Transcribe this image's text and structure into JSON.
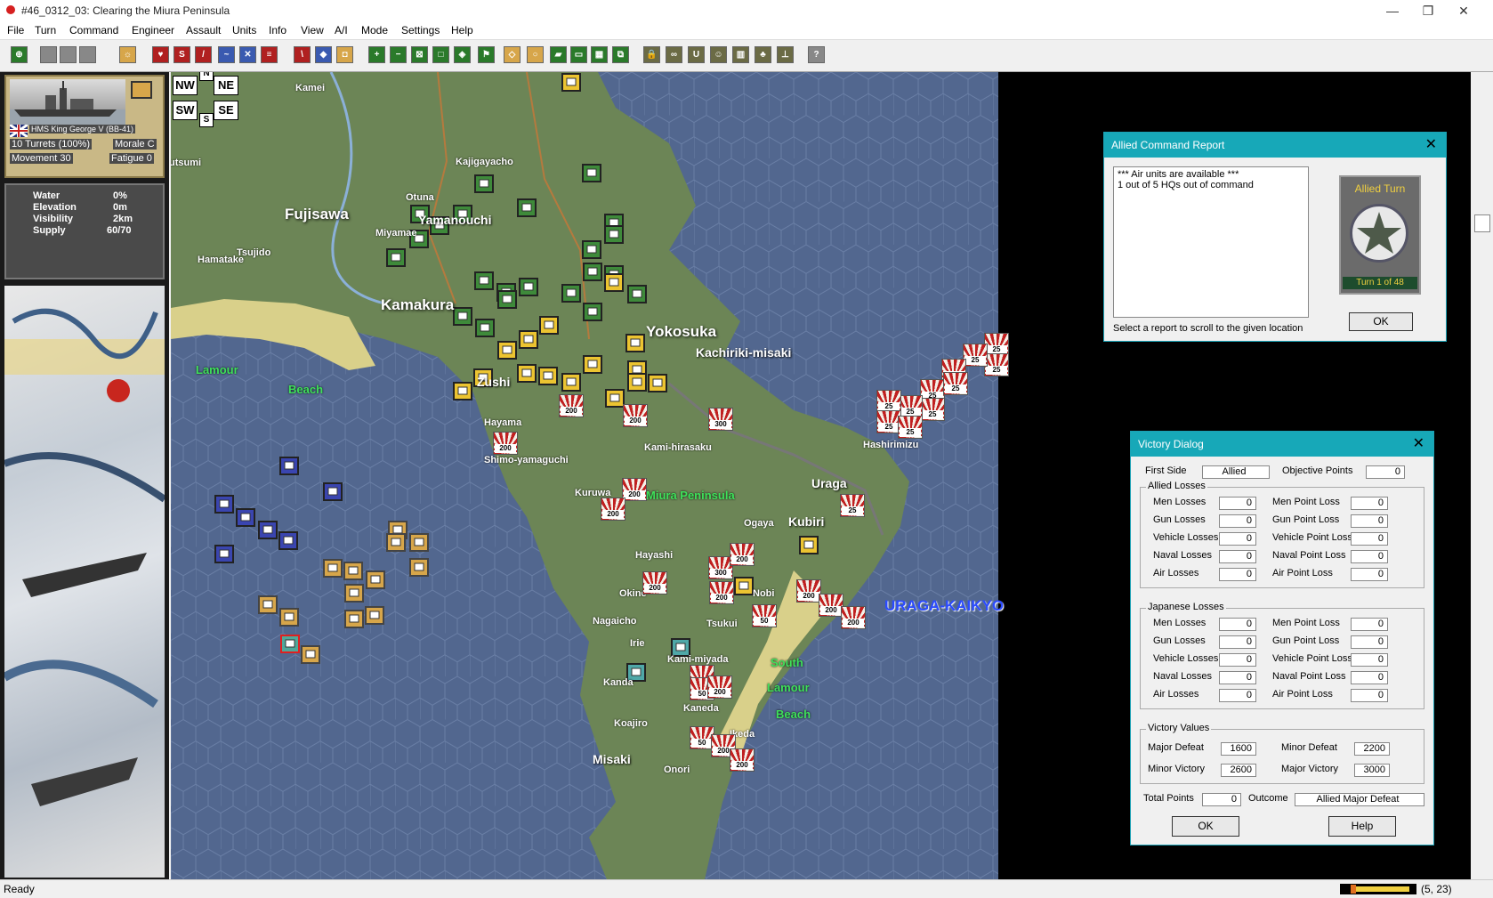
{
  "window": {
    "title": "#46_0312_03: Clearing the Miura Peninsula",
    "minimize": "—",
    "maximize": "❐",
    "close": "✕"
  },
  "menu": [
    "File",
    "Turn",
    "Command",
    "Engineer",
    "Assault",
    "Units",
    "Info",
    "View",
    "A/I",
    "Mode",
    "Settings",
    "Help"
  ],
  "unit_card": {
    "name": "HMS King George V (BB-41)",
    "turrets": "10 Turrets (100%)",
    "morale": "Morale C",
    "movement": "Movement 30",
    "fatigue": "Fatigue 0"
  },
  "terrain": {
    "labels": [
      "Water",
      "Elevation",
      "Visibility",
      "Supply"
    ],
    "values": [
      "0%",
      "0m",
      "2km",
      "60/70"
    ]
  },
  "compass": {
    "nw": "NW",
    "n": "N",
    "ne": "NE",
    "sw": "SW",
    "s": "S",
    "se": "SE"
  },
  "map_labels": [
    {
      "text": "Kamei",
      "kind": "small"
    },
    {
      "text": "Kajigayacho",
      "kind": "small"
    },
    {
      "text": "Tsutsumi",
      "kind": "small"
    },
    {
      "text": "Otuna",
      "kind": "small"
    },
    {
      "text": "Yamanouchi",
      "kind": "mid"
    },
    {
      "text": "Fujisawa",
      "kind": "big"
    },
    {
      "text": "Hamatake",
      "kind": "small"
    },
    {
      "text": "Tsujido",
      "kind": "small"
    },
    {
      "text": "Miyamae",
      "kind": "small"
    },
    {
      "text": "Kamakura",
      "kind": "big"
    },
    {
      "text": "Yokosuka",
      "kind": "big"
    },
    {
      "text": "Kachiriki-misaki",
      "kind": "mid"
    },
    {
      "text": "Lamour",
      "kind": "green"
    },
    {
      "text": "Beach",
      "kind": "green"
    },
    {
      "text": "Zushi",
      "kind": "mid"
    },
    {
      "text": "Hayama",
      "kind": "small"
    },
    {
      "text": "Shimo-yamaguchi",
      "kind": "small"
    },
    {
      "text": "Kami-hirasaku",
      "kind": "small"
    },
    {
      "text": "Hashirimizu",
      "kind": "small"
    },
    {
      "text": "Kuruwa",
      "kind": "small"
    },
    {
      "text": "Miura Peninsula",
      "kind": "green"
    },
    {
      "text": "Uraga",
      "kind": "mid"
    },
    {
      "text": "Ogaya",
      "kind": "small"
    },
    {
      "text": "Kubiri",
      "kind": "mid"
    },
    {
      "text": "Hayashi",
      "kind": "small"
    },
    {
      "text": "Okine",
      "kind": "small"
    },
    {
      "text": "Nobi",
      "kind": "small"
    },
    {
      "text": "Nagaicho",
      "kind": "small"
    },
    {
      "text": "Tsukui",
      "kind": "small"
    },
    {
      "text": "URAGA-KAIKYO",
      "kind": "blue"
    },
    {
      "text": "Irie",
      "kind": "small"
    },
    {
      "text": "Kami-miyada",
      "kind": "small"
    },
    {
      "text": "South",
      "kind": "green"
    },
    {
      "text": "Lamour",
      "kind": "green"
    },
    {
      "text": "Kanda",
      "kind": "small"
    },
    {
      "text": "Kaneda",
      "kind": "small"
    },
    {
      "text": "Beach",
      "kind": "green"
    },
    {
      "text": "Koajiro",
      "kind": "small"
    },
    {
      "text": "Ikeda",
      "kind": "small"
    },
    {
      "text": "Misaki",
      "kind": "mid"
    },
    {
      "text": "Onori",
      "kind": "small"
    }
  ],
  "japanese_units": [
    "200",
    "200",
    "300",
    "200",
    "200",
    "200",
    "200",
    "300",
    "200",
    "200",
    "200",
    "200",
    "200",
    "50",
    "50",
    "50",
    "50",
    "200",
    "200",
    "200",
    "25",
    "25",
    "25",
    "25",
    "25",
    "25",
    "25",
    "25",
    "25",
    "25",
    "25",
    "25"
  ],
  "command_report": {
    "title": "Allied Command Report",
    "lines": [
      "*** Air units are available ***",
      "1 out of 5 HQs out of command"
    ],
    "hint": "Select a report to scroll to the given location",
    "turn_side": "Allied Turn",
    "turn_text": "Turn   1   of  48",
    "ok": "OK"
  },
  "victory": {
    "title": "Victory Dialog",
    "first_side_label": "First Side",
    "first_side": "Allied",
    "objective_label": "Objective Points",
    "objective": "0",
    "allied_group": "Allied Losses",
    "japanese_group": "Japanese Losses",
    "loss_labels": [
      "Men Losses",
      "Gun Losses",
      "Vehicle Losses",
      "Naval Losses",
      "Air Losses"
    ],
    "point_labels": [
      "Men Point Loss",
      "Gun Point Loss",
      "Vehicle Point Loss",
      "Naval Point Loss",
      "Air Point Loss"
    ],
    "allied_losses": [
      "0",
      "0",
      "0",
      "0",
      "0"
    ],
    "allied_points": [
      "0",
      "0",
      "0",
      "0",
      "0"
    ],
    "japanese_losses": [
      "0",
      "0",
      "0",
      "0",
      "0"
    ],
    "japanese_points": [
      "0",
      "0",
      "0",
      "0",
      "0"
    ],
    "values_group": "Victory Values",
    "major_defeat_label": "Major Defeat",
    "major_defeat": "1600",
    "minor_defeat_label": "Minor Defeat",
    "minor_defeat": "2200",
    "minor_victory_label": "Minor Victory",
    "minor_victory": "2600",
    "major_victory_label": "Major Victory",
    "major_victory": "3000",
    "total_label": "Total Points",
    "total": "0",
    "outcome_label": "Outcome",
    "outcome": "Allied Major Defeat",
    "ok": "OK",
    "help": "Help"
  },
  "status": {
    "text": "Ready",
    "coords": "(5, 23)"
  },
  "colors": {
    "title_bar": "#17a8b8",
    "sea": "#52678f",
    "land": "#6c8556",
    "beach": "#d9d08a",
    "allied_navy": "#d7a64a",
    "allied_land": "#ecc431",
    "allied_hq": "#3a45b0",
    "enemy": "#c02020"
  }
}
